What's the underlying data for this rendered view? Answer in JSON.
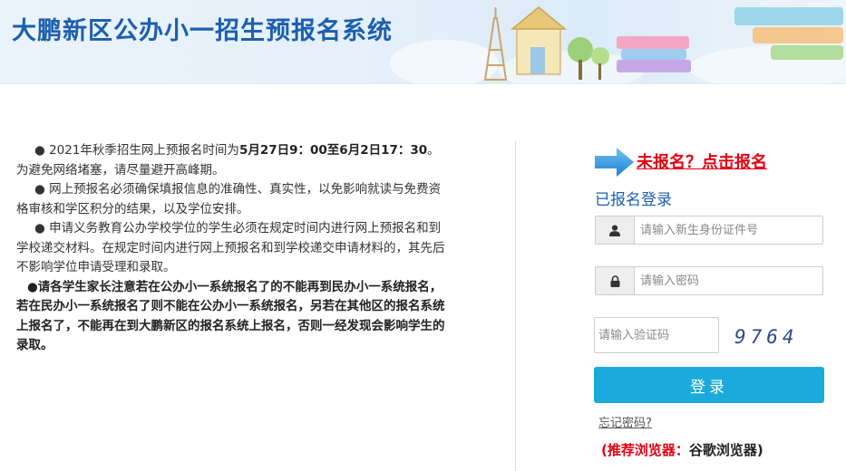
{
  "header": {
    "title": "大鹏新区公办小一招生预报名系统"
  },
  "notice": {
    "p1_pre": "● 2021年秋季招生网上预报名时间为",
    "p1_bold": "5月27日9：00至6月2日17：30",
    "p1_post": "。为避免网络堵塞，请尽量避开高峰期。",
    "p2": "● 网上预报名必须确保填报信息的准确性、真实性，以免影响就读与免费资格审核和学区积分的结果，以及学位安排。",
    "p3": "● 申请义务教育公办学校学位的学生必须在规定时间内进行网上预报名和到学校递交材料。在规定时间内进行网上预报名和到学校递交申请材料的，其先后不影响学位申请受理和录取。",
    "p4": "●请各学生家长注意若在公办小一系统报名了的不能再到民办小一系统报名，若在民办小一系统报名了则不能在公办小一系统报名，另若在其他区的报名系统上报名了，不能再在到大鹏新区的报名系统上报名，否则一经发现会影响学生的录取。"
  },
  "register": {
    "link_text": "未报名？点击报名"
  },
  "login": {
    "title": "已报名登录",
    "id_placeholder": "请输入新生身份证件号",
    "password_placeholder": "请输入密码",
    "captcha_placeholder": "请输入验证码",
    "captcha_code": "9764",
    "submit_label": "登录",
    "forgot_label": "忘记密码?"
  },
  "browser_tip": {
    "label": "(推荐浏览器：",
    "browser": "谷歌浏览器)"
  },
  "colors": {
    "brand_blue": "#1b5fae",
    "button_blue": "#1aabdc",
    "alert_red": "#e60012"
  }
}
